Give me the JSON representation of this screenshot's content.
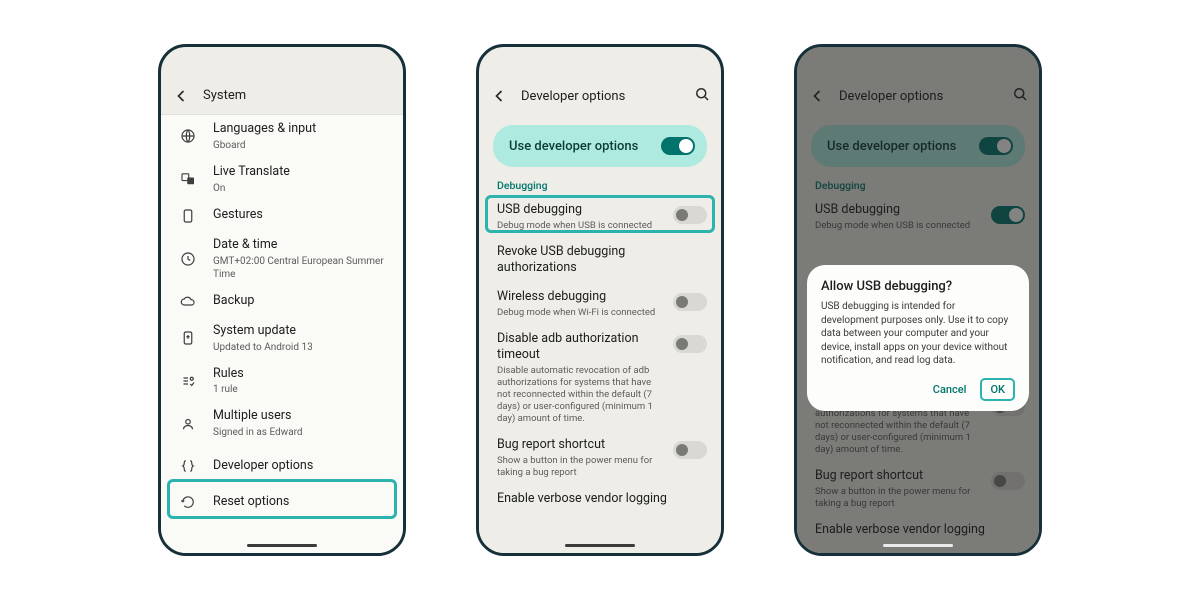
{
  "phone1": {
    "title": "System",
    "items": [
      {
        "label": "Languages & input",
        "sub": "Gboard",
        "icon": "globe"
      },
      {
        "label": "Live Translate",
        "sub": "On",
        "icon": "translate"
      },
      {
        "label": "Gestures",
        "sub": "",
        "icon": "gesture"
      },
      {
        "label": "Date & time",
        "sub": "GMT+02:00 Central European Summer Time",
        "icon": "clock"
      },
      {
        "label": "Backup",
        "sub": "",
        "icon": "cloud"
      },
      {
        "label": "System update",
        "sub": "Updated to Android 13",
        "icon": "update"
      },
      {
        "label": "Rules",
        "sub": "1 rule",
        "icon": "rules"
      },
      {
        "label": "Multiple users",
        "sub": "Signed in as Edward",
        "icon": "users"
      },
      {
        "label": "Developer options",
        "sub": "",
        "icon": "braces"
      },
      {
        "label": "Reset options",
        "sub": "",
        "icon": "reset"
      }
    ]
  },
  "phone2": {
    "title": "Developer options",
    "pill_label": "Use developer options",
    "section_label": "Debugging",
    "items": [
      {
        "title": "USB debugging",
        "desc": "Debug mode when USB is connected",
        "toggle": "off"
      },
      {
        "title": "Revoke USB debugging authorizations",
        "desc": "",
        "toggle": "none"
      },
      {
        "title": "Wireless debugging",
        "desc": "Debug mode when Wi-Fi is connected",
        "toggle": "off"
      },
      {
        "title": "Disable adb authorization timeout",
        "desc": "Disable automatic revocation of adb authorizations for systems that have not reconnected within the default (7 days) or user-configured (minimum 1 day) amount of time.",
        "toggle": "off"
      },
      {
        "title": "Bug report shortcut",
        "desc": "Show a button in the power menu for taking a bug report",
        "toggle": "off"
      },
      {
        "title": "Enable verbose vendor logging",
        "desc": "",
        "toggle": "none"
      }
    ]
  },
  "phone3": {
    "title": "Developer options",
    "pill_label": "Use developer options",
    "section_label": "Debugging",
    "items": [
      {
        "title": "USB debugging",
        "desc": "Debug mode when USB is connected",
        "toggle": "on"
      },
      {
        "title": "",
        "desc": "Disable automatic revocation of adb authorizations for systems that have not reconnected within the default (7 days) or user-configured (minimum 1 day) amount of time.",
        "toggle": "off"
      },
      {
        "title": "Bug report shortcut",
        "desc": "Show a button in the power menu for taking a bug report",
        "toggle": "off"
      },
      {
        "title": "Enable verbose vendor logging",
        "desc": "",
        "toggle": "none"
      }
    ],
    "dialog": {
      "title": "Allow USB debugging?",
      "body": "USB debugging is intended for development purposes only. Use it to copy data between your computer and your device, install apps on your device without notification, and read log data.",
      "cancel": "Cancel",
      "ok": "OK"
    }
  }
}
